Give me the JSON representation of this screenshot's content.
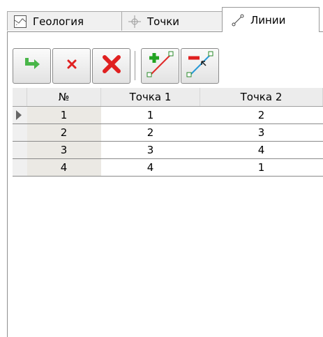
{
  "tabs": [
    {
      "label": "Геология",
      "icon": "geology-icon"
    },
    {
      "label": "Точки",
      "icon": "point-crosshair-icon"
    },
    {
      "label": "Линии",
      "icon": "line-icon",
      "active": true
    }
  ],
  "toolbar": {
    "buttons": [
      {
        "name": "apply-button",
        "icon": "green-arrow-icon"
      },
      {
        "name": "delete-button",
        "icon": "small-red-x-icon"
      },
      {
        "name": "delete-all-button",
        "icon": "big-red-x-icon"
      },
      {
        "name": "add-line-button",
        "icon": "add-line-icon"
      },
      {
        "name": "remove-line-button",
        "icon": "remove-line-icon"
      }
    ]
  },
  "grid": {
    "columns": [
      "№",
      "Точка 1",
      "Точка 2"
    ],
    "rows": [
      {
        "num": "1",
        "p1": "1",
        "p2": "2",
        "current": true
      },
      {
        "num": "2",
        "p1": "2",
        "p2": "3"
      },
      {
        "num": "3",
        "p1": "3",
        "p2": "4"
      },
      {
        "num": "4",
        "p1": "4",
        "p2": "1"
      }
    ]
  },
  "colors": {
    "delete_red": "#e02020",
    "add_green": "#22a322",
    "arrow_green": "#49b649"
  }
}
